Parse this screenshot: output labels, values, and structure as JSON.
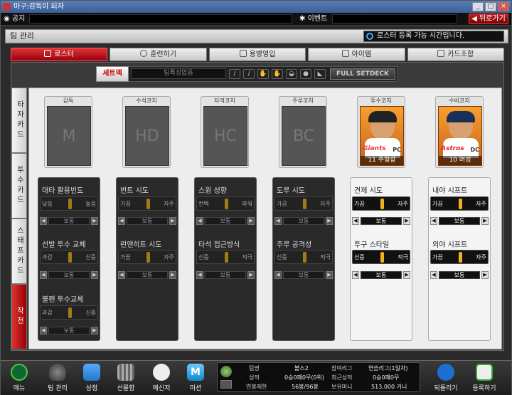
{
  "window": {
    "title": "마구:감독이 되자"
  },
  "noticebar": {
    "notice_label": "공지",
    "event_label": "이벤트",
    "back_label": "뒤로가기"
  },
  "header": {
    "title": "팀 관리",
    "message": "로스터 등록 가능 시간입니다."
  },
  "tabs": [
    {
      "label": "로스터"
    },
    {
      "label": "훈련하기"
    },
    {
      "label": "용병영입"
    },
    {
      "label": "아이템"
    },
    {
      "label": "카드조합"
    }
  ],
  "setdeck": {
    "button": "세트덱",
    "team_value": "팀특성없음",
    "full_label": "FULL SETDECK"
  },
  "sidetabs": [
    {
      "label": "타자카드"
    },
    {
      "label": "투수카드"
    },
    {
      "label": "스태프카드"
    },
    {
      "label": "작전"
    }
  ],
  "coaches": [
    {
      "role": "감독",
      "placeholder": "M"
    },
    {
      "role": "수석코치",
      "placeholder": "HD"
    },
    {
      "role": "타격코치",
      "placeholder": "HC"
    },
    {
      "role": "주루코치",
      "placeholder": "BC"
    },
    {
      "role": "투수코치",
      "team": "Giants",
      "pos": "PC",
      "name": "11 주형광"
    },
    {
      "role": "수비코치",
      "team": "Astros",
      "pos": "DC",
      "name": "10 머성"
    }
  ],
  "strategy": {
    "panel1": {
      "items": [
        {
          "title": "대타 활용빈도",
          "left": "낮음",
          "right": "높음",
          "value": "보통"
        },
        {
          "title": "선발 투수 교체",
          "left": "과감",
          "right": "신중",
          "value": "보통"
        },
        {
          "title": "불펜 투수교체",
          "left": "과감",
          "right": "신중",
          "value": "보통"
        }
      ]
    },
    "panel2": {
      "items": [
        {
          "title": "번트 시도",
          "left": "가끔",
          "right": "자주",
          "value": "보통"
        },
        {
          "title": "런앤히트 시도",
          "left": "가끔",
          "right": "자주",
          "value": "보통"
        }
      ]
    },
    "panel3": {
      "items": [
        {
          "title": "스윙 성향",
          "left": "컨택",
          "right": "파워",
          "value": "보통"
        },
        {
          "title": "타석 접근방식",
          "left": "신중",
          "right": "적극",
          "value": "보통"
        }
      ]
    },
    "panel4": {
      "items": [
        {
          "title": "도루 시도",
          "left": "가끔",
          "right": "자주",
          "value": "보통"
        },
        {
          "title": "주루 공격성",
          "left": "신중",
          "right": "적극",
          "value": "보통"
        }
      ]
    },
    "panel5": {
      "items": [
        {
          "title": "견제 시도",
          "left": "가끔",
          "right": "자주",
          "value": "보통"
        },
        {
          "title": "투구 스타일",
          "left": "신중",
          "right": "적극",
          "value": "보통"
        }
      ]
    },
    "panel6": {
      "items": [
        {
          "title": "내야 시프트",
          "left": "가끔",
          "right": "자주",
          "value": "보통"
        },
        {
          "title": "외야 시프트",
          "left": "가끔",
          "right": "자주",
          "value": "보통"
        }
      ]
    }
  },
  "bottombar": {
    "menu": "메뉴",
    "team": "팀 관리",
    "shop": "상점",
    "gift": "선물함",
    "messenger": "메신저",
    "mission": "미션",
    "back": "되돌리기",
    "register": "등록하기",
    "mission_glyph": "M",
    "info": {
      "team_key": "팀명",
      "team_val": "볼스2",
      "record_key": "성적",
      "record_val": "0승0패0무(0위)",
      "salary_key": "연봉제한",
      "salary_val": "56봉/96봉",
      "league_key": "참여리그",
      "league_val": "연습리그(1일차)",
      "recent_key": "최근성적",
      "recent_val": "0승0패0무",
      "money_key": "보유머니",
      "money_val": "513,000 거니"
    }
  }
}
